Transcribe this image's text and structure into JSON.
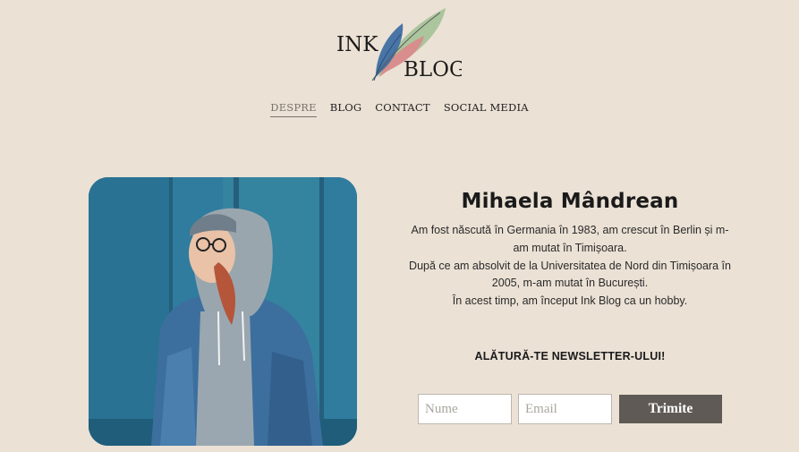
{
  "logo": {
    "text_line1": "INK",
    "text_line2": "BLOG",
    "colors": {
      "feather_blue": "#3f6fa3",
      "feather_red": "#d98b8b",
      "feather_green": "#a8c39a"
    }
  },
  "nav": {
    "items": [
      {
        "label": "DESPRE",
        "active": true
      },
      {
        "label": "BLOG",
        "active": false
      },
      {
        "label": "CONTACT",
        "active": false
      },
      {
        "label": "SOCIAL MEDIA",
        "active": false
      }
    ]
  },
  "profile": {
    "name": "Mihaela Mândrean",
    "bio_lines": [
      "Am fost născută în Germania în 1983, am crescut în Berlin și m-",
      "am mutat în Timișoara.",
      "După ce am absolvit de la Universitatea de Nord din Timișoara în",
      "2005, m-am mutat în București.",
      "În acest timp, am început Ink Blog ca un hobby."
    ]
  },
  "newsletter": {
    "title": "ALĂTURĂ-TE NEWSLETTER-ULUI!",
    "name_placeholder": "Nume",
    "email_placeholder": "Email",
    "submit_label": "Trimite"
  },
  "colors": {
    "background": "#ebe1d5",
    "button": "#5f5a55",
    "photo_wall": "#2f7c9e"
  }
}
